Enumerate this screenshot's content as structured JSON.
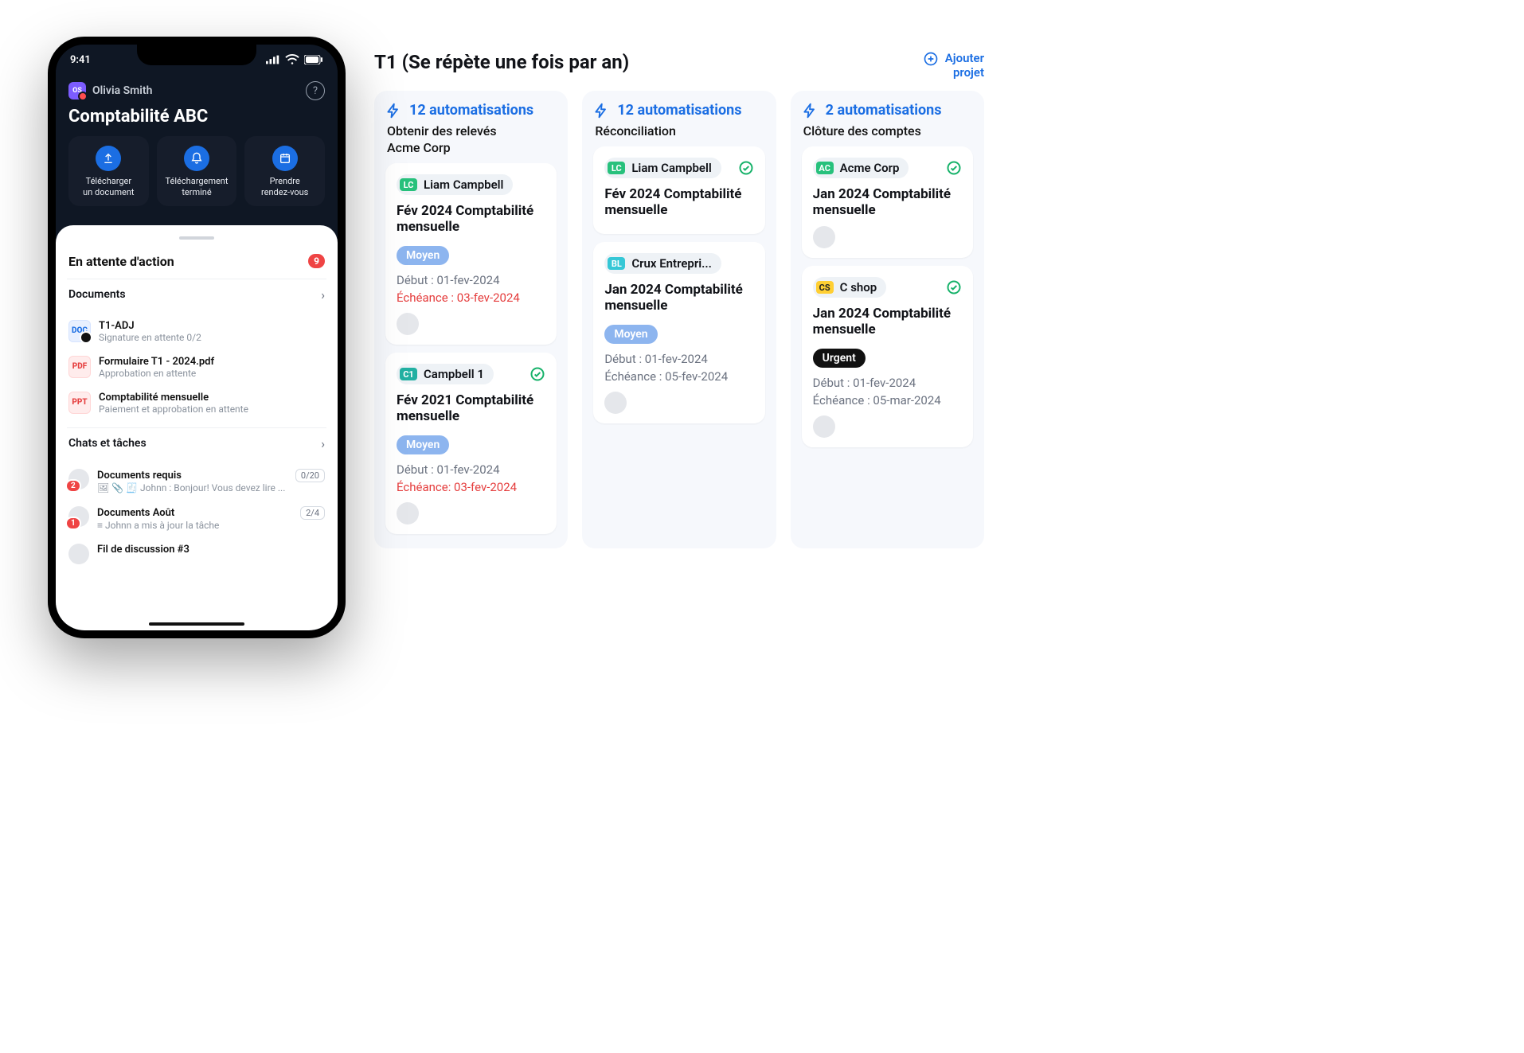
{
  "desktop": {
    "title": "T1 (Se répète une fois par an)",
    "add": {
      "plus": "+",
      "line1": "Ajouter",
      "line2": "projet"
    },
    "columns": [
      {
        "automations": "12 automatisations",
        "subtitle1": "Obtenir des relevés",
        "subtitle2": "Acme Corp",
        "cards": [
          {
            "iniCls": "green",
            "ini": "LC",
            "name": "Liam Campbell",
            "check": false,
            "title": "Fév 2024 Comptabilité mensuelle",
            "pill": "Moyen",
            "pillCls": "medium",
            "start": "Début : 01-fev-2024",
            "due": "Échéance : 03-fev-2024",
            "dueRed": true,
            "avatar": true
          },
          {
            "iniCls": "teal",
            "ini": "C1",
            "name": "Campbell 1",
            "check": true,
            "title": "Fév 2021 Comptabilité mensuelle",
            "pill": "Moyen",
            "pillCls": "medium",
            "start": "Début : 01-fev-2024",
            "due": "Échéance: 03-fev-2024",
            "dueRed": true,
            "avatar": true
          }
        ]
      },
      {
        "automations": "12 automatisations",
        "subtitle1": "Réconciliation",
        "subtitle2": "",
        "cards": [
          {
            "iniCls": "green",
            "ini": "LC",
            "name": "Liam Campbell",
            "check": true,
            "title": "Fév 2024 Comptabilité mensuelle",
            "pill": "",
            "pillCls": "",
            "start": "",
            "due": "",
            "dueRed": false,
            "avatar": false
          },
          {
            "iniCls": "lblue",
            "ini": "BL",
            "name": "Crux Entrepri...",
            "check": false,
            "title": "Jan 2024 Comptabilité mensuelle",
            "pill": "Moyen",
            "pillCls": "medium",
            "start": "Début : 01-fev-2024",
            "due": "Échéance : 05-fev-2024",
            "dueRed": false,
            "avatar": true
          }
        ]
      },
      {
        "automations": "2 automatisations",
        "subtitle1": "Clôture des comptes",
        "subtitle2": "",
        "cards": [
          {
            "iniCls": "green",
            "ini": "AC",
            "name": "Acme Corp",
            "check": true,
            "title": "Jan 2024 Comptabilité mensuelle",
            "pill": "",
            "pillCls": "",
            "start": "",
            "due": "",
            "dueRed": false,
            "avatar": true
          },
          {
            "iniCls": "yellow",
            "ini": "CS",
            "name": "C shop",
            "check": true,
            "title": "Jan 2024 Comptabilité mensuelle",
            "pill": "Urgent",
            "pillCls": "urgent",
            "start": "Début : 01-fev-2024",
            "due": "Échéance : 05-mar-2024",
            "dueRed": false,
            "avatar": true
          }
        ]
      }
    ]
  },
  "phone": {
    "time": "9:41",
    "user": {
      "initials": "OS",
      "name": "Olivia Smith"
    },
    "heading": "Comptabilité ABC",
    "actions": [
      {
        "label": "Télécharger\nun document",
        "icon": "upload"
      },
      {
        "label": "Téléchargement\nterminé",
        "icon": "bell"
      },
      {
        "label": "Prendre\nrendez-vous",
        "icon": "calendar"
      }
    ],
    "pending": {
      "title": "En attente d'action",
      "count": "9"
    },
    "docs": {
      "title": "Documents",
      "items": [
        {
          "icon": "doc1",
          "iconText": "DOC",
          "a": "T1-ADJ",
          "b": "Signature en attente 0/2"
        },
        {
          "icon": "pdf",
          "iconText": "PDF",
          "a": "Formulaire T1 - 2024.pdf",
          "b": "Approbation en attente"
        },
        {
          "icon": "ppt",
          "iconText": "PPT",
          "a": "Comptabilité mensuelle",
          "b": "Paiement et approbation en attente"
        }
      ]
    },
    "chats": {
      "title": "Chats et tâches",
      "items": [
        {
          "badge": "2",
          "a": "Documents requis",
          "right": "0/20",
          "b": "🖼 📎 🧾 Johnn : Bonjour! Vous devez lire ..."
        },
        {
          "badge": "1",
          "a": "Documents Août",
          "right": "2/4",
          "b": "≡ Johnn a mis à jour la tâche"
        },
        {
          "badge": "",
          "a": "Fil de discussion #3",
          "right": "",
          "b": ""
        }
      ]
    }
  }
}
